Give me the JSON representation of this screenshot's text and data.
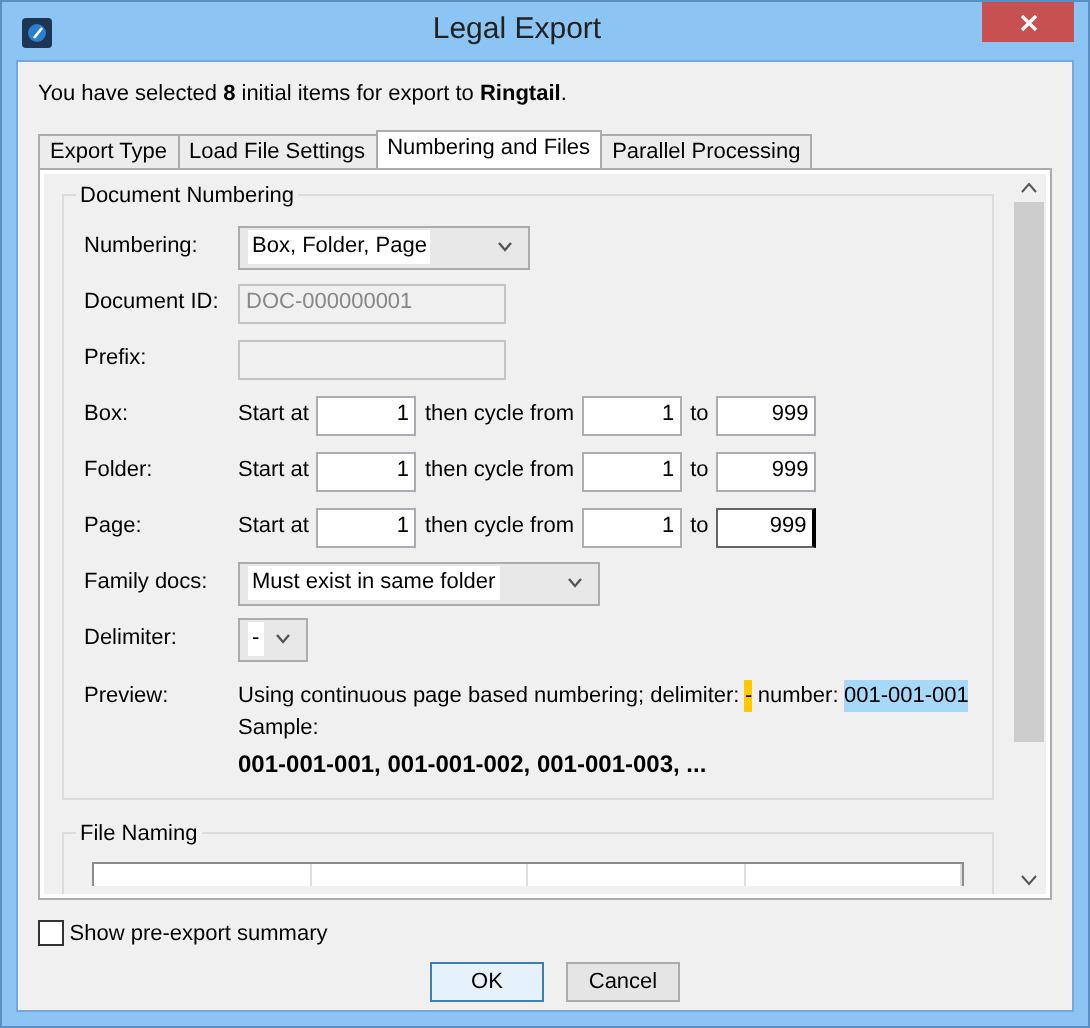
{
  "window": {
    "title": "Legal Export"
  },
  "intro": "You have selected **8** initial items for export to **Ringtail**.",
  "tabs": [
    {
      "label": "Export Type",
      "selected": false
    },
    {
      "label": "Load File Settings",
      "selected": false
    },
    {
      "label": "Numbering and Files",
      "selected": true
    },
    {
      "label": "Parallel Processing",
      "selected": false
    }
  ],
  "document_numbering": {
    "title": "Document Numbering",
    "fields": [
      {
        "kind": "select",
        "label": "Numbering:",
        "value": "Box, Folder, Page"
      },
      {
        "kind": "text",
        "label": "Document ID:",
        "value": "DOC-000000001",
        "disabled": true
      },
      {
        "kind": "text",
        "label": "Prefix:",
        "disabled": true
      },
      {
        "kind": "range",
        "label": "Box:",
        "start_label": "Start at",
        "start": "1",
        "cycle_label": "then cycle from",
        "from": "1",
        "to_label": "to",
        "to": "999",
        "focused": false
      },
      {
        "kind": "range",
        "label": "Folder:",
        "start_label": "Start at",
        "start": "1",
        "cycle_label": "then cycle from",
        "from": "1",
        "to_label": "to",
        "to": "999",
        "focused": false
      },
      {
        "kind": "range",
        "label": "Page:",
        "start_label": "Start at",
        "start": "1",
        "cycle_label": "then cycle from",
        "from": "1",
        "to_label": "to",
        "to": "999",
        "focused": true
      },
      {
        "kind": "select",
        "label": "Family docs:",
        "value": "Must exist in same folder"
      },
      {
        "kind": "select",
        "label": "Delimiter:",
        "value": "-"
      }
    ],
    "preview": {
      "label": "Preview:",
      "text": "Using continuous page based numbering; delimiter:",
      "delimiter": "-",
      "number_label": "number:",
      "number": "001-001-001",
      "sample_label": "Sample:",
      "sample": "001-001-001, 001-001-002, 001-001-003, ..."
    }
  },
  "file_naming": {
    "title": "File Naming"
  },
  "show_summary": {
    "label": "Show pre-export summary",
    "checked": false
  },
  "buttons": [
    {
      "label": "OK",
      "default": true
    },
    {
      "label": "Cancel",
      "default": false
    }
  ]
}
